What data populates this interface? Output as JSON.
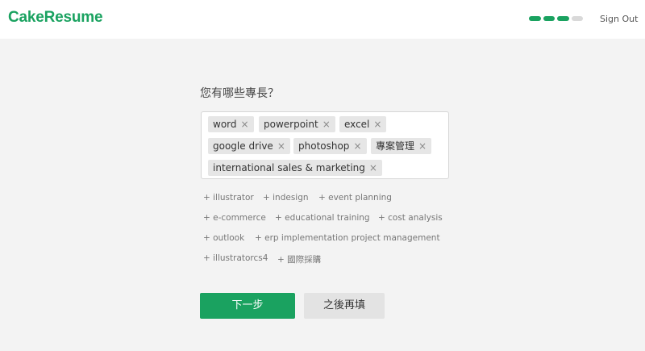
{
  "header": {
    "logo": "CakeResume",
    "signout_label": "Sign Out",
    "progress": {
      "completed": 3,
      "total": 4
    }
  },
  "question": "您有哪些專長？",
  "tags": [
    {
      "label": "word"
    },
    {
      "label": "powerpoint"
    },
    {
      "label": "excel"
    },
    {
      "label": "google drive"
    },
    {
      "label": "photoshop"
    },
    {
      "label": "專案管理"
    },
    {
      "label": "international sales & marketing"
    }
  ],
  "remove_glyph": "×",
  "suggestions": [
    {
      "label": "+ illustrator"
    },
    {
      "label": "+ indesign"
    },
    {
      "label": "+ event planning"
    },
    {
      "label": "+ e-commerce"
    },
    {
      "label": "+ educational training"
    },
    {
      "label": "+ cost analysis"
    },
    {
      "label": "+ outlook"
    },
    {
      "label": "+ erp implementation project management"
    },
    {
      "label": "+ illustratorcs4"
    },
    {
      "label": "+ 國際採購"
    }
  ],
  "buttons": {
    "next_label": "下一步",
    "later_label": "之後再填"
  },
  "colors": {
    "brand": "#1aa260",
    "background": "#f3f3f3",
    "tag_bg": "#e6e6e6"
  }
}
